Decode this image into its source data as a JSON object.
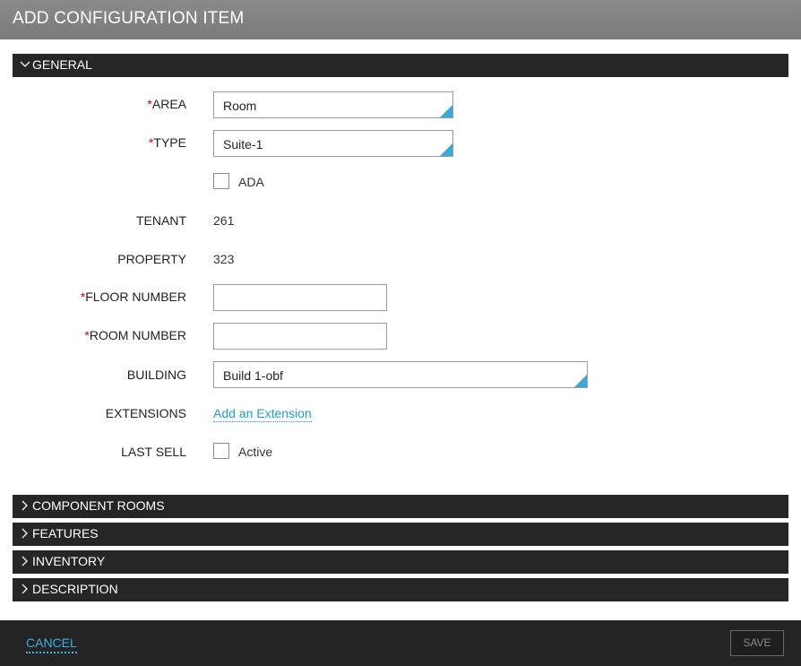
{
  "dialog": {
    "title": "ADD CONFIGURATION ITEM"
  },
  "sections": {
    "general": "GENERAL",
    "component_rooms": "COMPONENT ROOMS",
    "features": "FEATURES",
    "inventory": "INVENTORY",
    "description": "DESCRIPTION"
  },
  "form": {
    "required_marker": "*",
    "area": {
      "label": "AREA",
      "value": "Room"
    },
    "type": {
      "label": "TYPE",
      "value": "Suite-1"
    },
    "ada": {
      "label": "ADA",
      "checked": false
    },
    "tenant": {
      "label": "TENANT",
      "value": "261"
    },
    "property": {
      "label": "PROPERTY",
      "value": "323"
    },
    "floor_number": {
      "label": "FLOOR NUMBER",
      "value": ""
    },
    "room_number": {
      "label": "ROOM NUMBER",
      "value": ""
    },
    "building": {
      "label": "BUILDING",
      "value": "Build 1-obf"
    },
    "extensions": {
      "label": "EXTENSIONS",
      "link": "Add an Extension"
    },
    "last_sell": {
      "label": "LAST SELL",
      "checkbox_label": "Active",
      "checked": false
    }
  },
  "footer": {
    "cancel": "CANCEL",
    "save": "SAVE"
  },
  "colors": {
    "accent": "#3aa9d9",
    "required": "#d0021b",
    "header_bg": "#262626"
  }
}
